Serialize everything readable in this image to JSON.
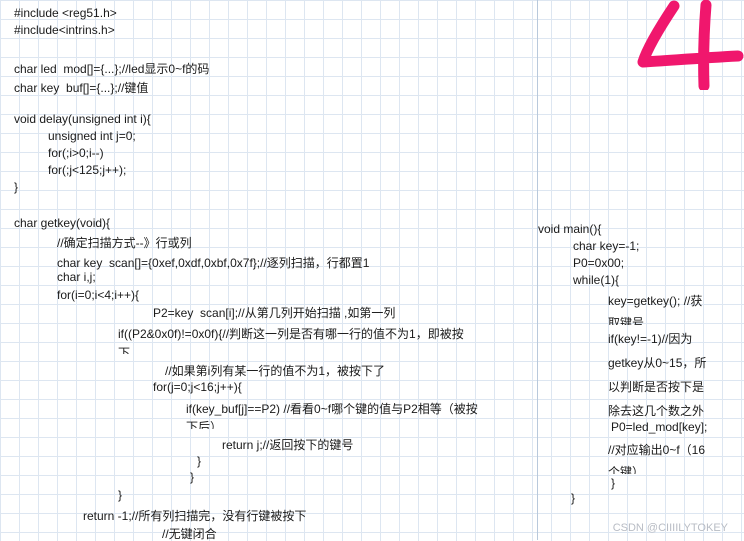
{
  "left": {
    "include_1": "#include <reg51.h>",
    "include_2": "#include<intrins.h>",
    "decl_led": "char led  mod[]={...};//led显示0~f的码",
    "decl_key": "char key  buf[]={...};//键值",
    "delay_sig": "void delay(unsigned int i){",
    "delay_1": "unsigned int j=0;",
    "delay_2": "for(;i>0;i--)",
    "delay_3": "for(;j<125;j++);",
    "delay_end": "}",
    "getkey_sig": "char getkey(void){",
    "getkey_comment": "//确定扫描方式--》行或列",
    "scan_decl": "char key  scan[]={0xef,0xdf,0xbf,0x7f};//逐列扫描，行都置1",
    "ij_decl": "char i,j;",
    "for_i": "for(i=0;i<4;i++){",
    "p2_assign": "P2=key  scan[i];//从第几列开始扫描 ,如第一列",
    "if_p2_l1": "if((P2&0x0f)!=0x0f){//判断这一列是否有哪一行的值不为1，即被按",
    "if_p2_l2": "下",
    "row_comment": "//如果第i列有某一行的值不为1，被按下了",
    "for_j": "for(j=0;j<16;j++){",
    "if_buf_l1": "if(key_buf[j]==P2) //看看0~f哪个键的值与P2相等（被按",
    "if_buf_l2": "下后）",
    "return_j": "return j;//返回按下的键号",
    "brace_a": "}",
    "brace_b": "}",
    "brace_c": "}",
    "return_neg": "return -1;//所有列扫描完，没有行键被按下",
    "no_key": "//无键闭合"
  },
  "right": {
    "main_sig": "void main(){",
    "key_init": "char key=-1;",
    "p0_init": "P0=0x00;",
    "while_loop": "while(1){",
    "getkey_call_l1": "key=getkey(); //获",
    "getkey_call_l2": "取键号",
    "if_key_l1": "if(key!=-1)//因为",
    "if_key_l2": "getkey从0~15，所",
    "if_key_l3": "以判断是否按下是",
    "if_key_l4": "除去这几个数之外",
    "p0_assign": "P0=led_mod[key];",
    "output_l1": "//对应输出0~f（16",
    "output_l2": "个键）",
    "brace_inner": "}",
    "brace_outer": "}"
  },
  "annotation": {
    "digit": "4",
    "color": "#f0176d"
  },
  "watermark": "CSDN @CIIIILYTOKEY"
}
